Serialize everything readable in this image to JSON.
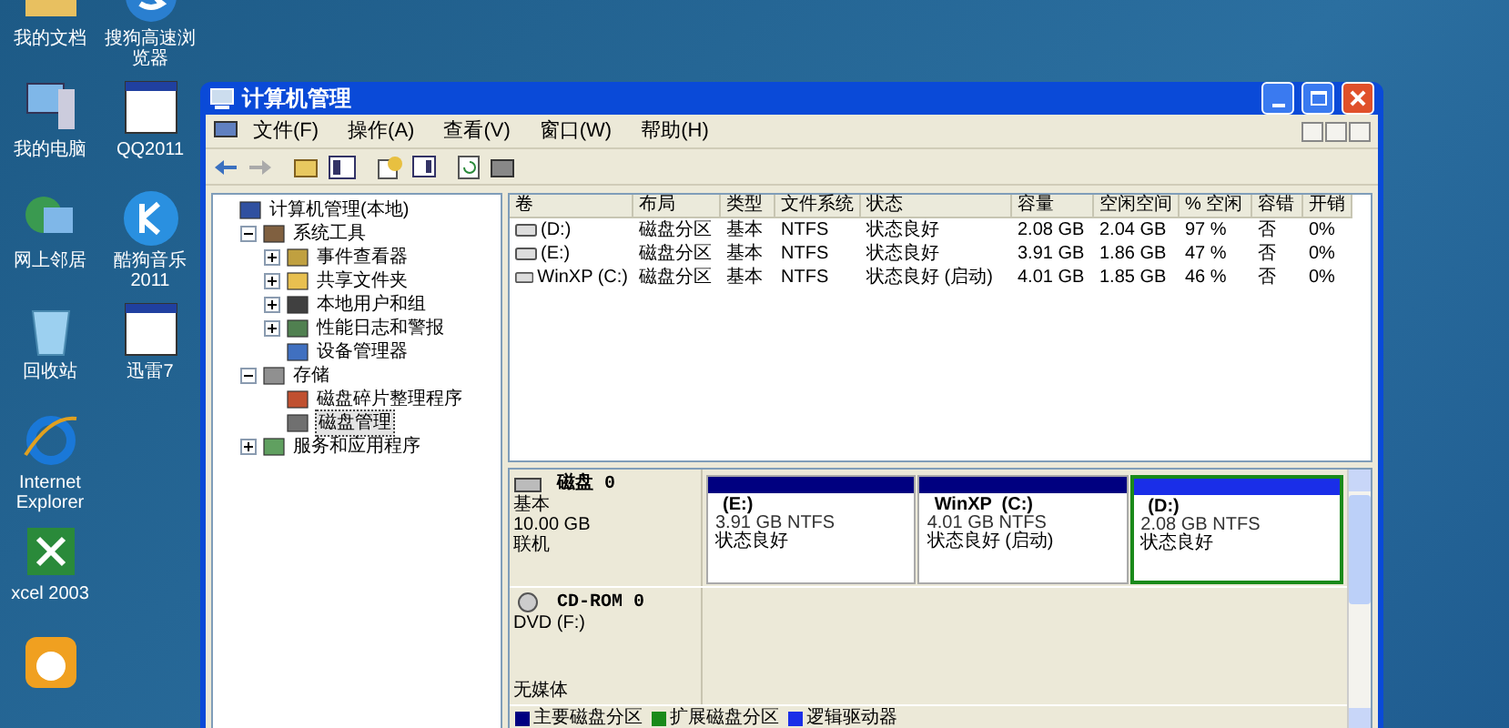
{
  "desktop_icons": [
    {
      "label": "我的文档",
      "kind": "folder"
    },
    {
      "label": "搜狗高速浏览器",
      "kind": "browser"
    },
    {
      "label": "我的电脑",
      "kind": "computer"
    },
    {
      "label": "QQ2011",
      "kind": "window"
    },
    {
      "label": "网上邻居",
      "kind": "network"
    },
    {
      "label": "酷狗音乐 2011",
      "kind": "music"
    },
    {
      "label": "回收站",
      "kind": "bin"
    },
    {
      "label": "迅雷7",
      "kind": "window"
    },
    {
      "label": "Internet Explorer",
      "kind": "ie"
    },
    {
      "kind": "none"
    },
    {
      "label": "xcel 2003",
      "kind": "excel"
    },
    {
      "kind": "none"
    },
    {
      "kind": "chat"
    }
  ],
  "window": {
    "title": "计算机管理",
    "menu": [
      "文件(F)",
      "操作(A)",
      "查看(V)",
      "窗口(W)",
      "帮助(H)"
    ],
    "tree": [
      {
        "label": "计算机管理(本地)",
        "kind": "computer",
        "selected": false,
        "children": [
          {
            "label": "系统工具",
            "kind": "tools",
            "expanded": true,
            "selected": false,
            "children": [
              {
                "label": "事件查看器",
                "kind": "viewer",
                "expanded": false,
                "selected": false
              },
              {
                "label": "共享文件夹",
                "kind": "folder",
                "expanded": false,
                "selected": false
              },
              {
                "label": "本地用户和组",
                "kind": "users",
                "expanded": false,
                "selected": false
              },
              {
                "label": "性能日志和警报",
                "kind": "chart",
                "expanded": false,
                "selected": false
              },
              {
                "label": "设备管理器",
                "kind": "device",
                "selected": false
              }
            ]
          },
          {
            "label": "存储",
            "kind": "storage",
            "expanded": true,
            "selected": false,
            "children": [
              {
                "label": "磁盘碎片整理程序",
                "kind": "defrag",
                "selected": false
              },
              {
                "label": "磁盘管理",
                "kind": "disk",
                "selected": true
              }
            ]
          },
          {
            "label": "服务和应用程序",
            "kind": "services",
            "expanded": false,
            "selected": false
          }
        ]
      }
    ],
    "table": {
      "columns": [
        "卷",
        "布局",
        "类型",
        "文件系统",
        "状态",
        "容量",
        "空闲空间",
        "% 空闲",
        "容错",
        "开销"
      ],
      "rows": [
        [
          "(D:)",
          "磁盘分区",
          "基本",
          "NTFS",
          "状态良好",
          "2.08 GB",
          "2.04 GB",
          "97 %",
          "否",
          "0%"
        ],
        [
          "(E:)",
          "磁盘分区",
          "基本",
          "NTFS",
          "状态良好",
          "3.91 GB",
          "1.86 GB",
          "47 %",
          "否",
          "0%"
        ],
        [
          "WinXP (C:)",
          "磁盘分区",
          "基本",
          "NTFS",
          "状态良好 (启动)",
          "4.01 GB",
          "1.85 GB",
          "46 %",
          "否",
          "0%"
        ]
      ]
    },
    "disks": [
      {
        "kind": "disk",
        "name": "磁盘 0",
        "type": "基本",
        "size": "10.00 GB",
        "status": "联机",
        "partitions": [
          {
            "label": "(E:)",
            "size_fs": "3.91 GB NTFS",
            "status": "状态良好",
            "color": "#000080",
            "in_extended": false
          },
          {
            "label": "WinXP  (C:)",
            "size_fs": "4.01 GB NTFS",
            "status": "状态良好 (启动)",
            "color": "#000080",
            "in_extended": false
          },
          {
            "label": "(D:)",
            "size_fs": "2.08 GB NTFS",
            "status": "状态良好",
            "color": "#1a2ee8",
            "in_extended": true
          }
        ]
      },
      {
        "kind": "cdrom",
        "name": "CD-ROM 0",
        "type": "DVD (F:)",
        "status": "无媒体"
      }
    ],
    "legend": [
      {
        "label": "主要磁盘分区",
        "color": "#000080"
      },
      {
        "label": "扩展磁盘分区",
        "color": "#1a8a1a"
      },
      {
        "label": "逻辑驱动器",
        "color": "#1a2ee8"
      }
    ]
  }
}
